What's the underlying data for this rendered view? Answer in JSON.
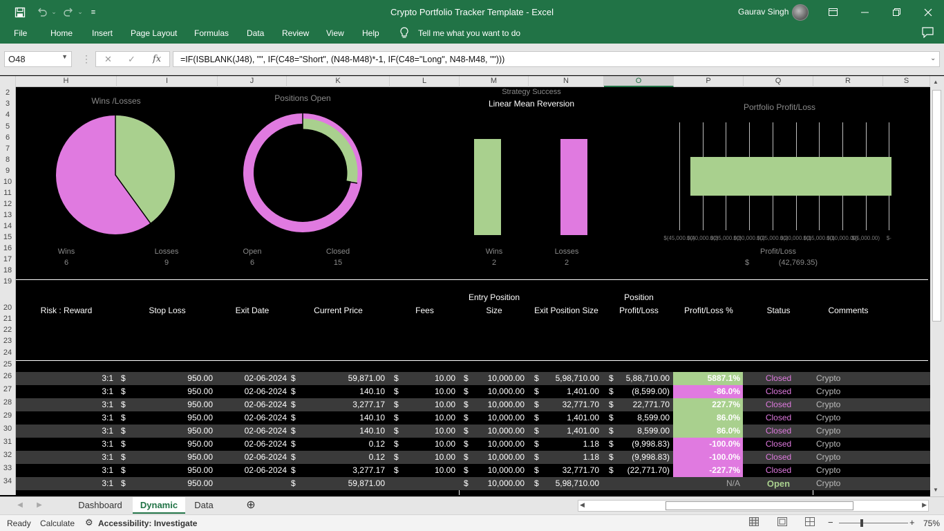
{
  "window": {
    "title": "Crypto Portfolio Tracker Template  -  Excel",
    "user": "Gaurav Singh"
  },
  "quick_access": {
    "save_icon": "save-icon",
    "undo_icon": "undo-icon",
    "redo_icon": "redo-icon"
  },
  "menu": [
    "File",
    "Home",
    "Insert",
    "Page Layout",
    "Formulas",
    "Data",
    "Review",
    "View",
    "Help"
  ],
  "tell_me": "Tell me what you want to do",
  "formula_bar": {
    "name_box": "O48",
    "fx": "fx",
    "formula": "=IF(ISBLANK(J48), \"\", IF(C48=\"Short\", (N48-M48)*-1, IF(C48=\"Long\", N48-M48, \"\")))"
  },
  "columns": [
    "H",
    "I",
    "J",
    "K",
    "L",
    "M",
    "N",
    "O",
    "P",
    "Q",
    "R",
    "S"
  ],
  "selected_column": "O",
  "row_numbers": [
    "2",
    "3",
    "4",
    "5",
    "6",
    "7",
    "8",
    "9",
    "10",
    "11",
    "12",
    "13",
    "14",
    "15",
    "16",
    "17",
    "18",
    "19",
    "20",
    "21",
    "22",
    "23",
    "24",
    "25",
    "26",
    "27",
    "28",
    "29",
    "30",
    "31",
    "32",
    "33",
    "34"
  ],
  "charts": {
    "wins_losses": {
      "title": "Wins /Losses",
      "win_label": "Wins",
      "loss_label": "Losses",
      "wins": "6",
      "losses": "9"
    },
    "positions_open": {
      "title": "Positions Open",
      "open_label": "Open",
      "closed_label": "Closed",
      "open": "6",
      "closed": "15"
    },
    "strategy": {
      "title": "Strategy Success",
      "subtitle": "Linear Mean Reversion",
      "win_label": "Wins",
      "loss_label": "Losses",
      "wins": "2",
      "losses": "2"
    },
    "portfolio": {
      "title": "Portfolio Profit/Loss",
      "label": "Profit/Loss",
      "currency": "$",
      "value": "(42,769.35)",
      "ticks": [
        "$(45,000.00)",
        "$(40,000.00)",
        "$(35,000.00)",
        "$(30,000.00)",
        "$(25,000.00)",
        "$(20,000.00)",
        "$(15,000.00)",
        "$(10,000.00)",
        "$(5,000.00)",
        "$-"
      ]
    }
  },
  "chart_data": [
    {
      "type": "pie",
      "title": "Wins /Losses",
      "categories": [
        "Wins",
        "Losses"
      ],
      "values": [
        6,
        9
      ],
      "colors": [
        "#a9d08e",
        "#e07ae0"
      ]
    },
    {
      "type": "pie",
      "title": "Positions Open",
      "categories": [
        "Open",
        "Closed"
      ],
      "values": [
        6,
        15
      ],
      "colors": [
        "#a9d08e",
        "#e07ae0"
      ]
    },
    {
      "type": "bar",
      "title": "Strategy Success",
      "subtitle": "Linear Mean Reversion",
      "categories": [
        "Wins",
        "Losses"
      ],
      "values": [
        2,
        2
      ],
      "colors": [
        "#a9d08e",
        "#e07ae0"
      ]
    },
    {
      "type": "bar",
      "title": "Portfolio Profit/Loss",
      "categories": [
        "Profit/Loss"
      ],
      "values": [
        -42769.35
      ],
      "xlim": [
        -45000,
        0
      ],
      "orientation": "horizontal",
      "color": "#a9d08e"
    }
  ],
  "table_headers": {
    "risk_reward": "Risk : Reward",
    "stop_loss": "Stop Loss",
    "exit_date": "Exit Date",
    "current_price": "Current Price",
    "fees": "Fees",
    "entry_size_1": "Entry Position",
    "entry_size_2": "Size",
    "exit_size": "Exit Position Size",
    "pl_1": "Position",
    "pl_2": "Profit/Loss",
    "pl_pct": "Profit/Loss %",
    "status": "Status",
    "comments": "Comments"
  },
  "rows": [
    {
      "rr": "3:1",
      "stop": "950.00",
      "exit": "02-06-2024",
      "price": "59,871.00",
      "fees": "10.00",
      "entry": "10,000.00",
      "exitsize": "5,98,710.00",
      "pl": "5,88,710.00",
      "pct": "5887.1%",
      "pct_color": "#a9d08e",
      "status": "Closed",
      "comments": "Crypto"
    },
    {
      "rr": "3:1",
      "stop": "950.00",
      "exit": "02-06-2024",
      "price": "140.10",
      "fees": "10.00",
      "entry": "10,000.00",
      "exitsize": "1,401.00",
      "pl": "(8,599.00)",
      "pct": "-86.0%",
      "pct_color": "#e07ae0",
      "status": "Closed",
      "comments": "Crypto"
    },
    {
      "rr": "3:1",
      "stop": "950.00",
      "exit": "02-06-2024",
      "price": "3,277.17",
      "fees": "10.00",
      "entry": "10,000.00",
      "exitsize": "32,771.70",
      "pl": "22,771.70",
      "pct": "227.7%",
      "pct_color": "#a9d08e",
      "status": "Closed",
      "comments": "Crypto"
    },
    {
      "rr": "3:1",
      "stop": "950.00",
      "exit": "02-06-2024",
      "price": "140.10",
      "fees": "10.00",
      "entry": "10,000.00",
      "exitsize": "1,401.00",
      "pl": "8,599.00",
      "pct": "86.0%",
      "pct_color": "#a9d08e",
      "status": "Closed",
      "comments": "Crypto"
    },
    {
      "rr": "3:1",
      "stop": "950.00",
      "exit": "02-06-2024",
      "price": "140.10",
      "fees": "10.00",
      "entry": "10,000.00",
      "exitsize": "1,401.00",
      "pl": "8,599.00",
      "pct": "86.0%",
      "pct_color": "#a9d08e",
      "status": "Closed",
      "comments": "Crypto"
    },
    {
      "rr": "3:1",
      "stop": "950.00",
      "exit": "02-06-2024",
      "price": "0.12",
      "fees": "10.00",
      "entry": "10,000.00",
      "exitsize": "1.18",
      "pl": "(9,998.83)",
      "pct": "-100.0%",
      "pct_color": "#e07ae0",
      "status": "Closed",
      "comments": "Crypto"
    },
    {
      "rr": "3:1",
      "stop": "950.00",
      "exit": "02-06-2024",
      "price": "0.12",
      "fees": "10.00",
      "entry": "10,000.00",
      "exitsize": "1.18",
      "pl": "(9,998.83)",
      "pct": "-100.0%",
      "pct_color": "#e07ae0",
      "status": "Closed",
      "comments": "Crypto"
    },
    {
      "rr": "3:1",
      "stop": "950.00",
      "exit": "02-06-2024",
      "price": "3,277.17",
      "fees": "10.00",
      "entry": "10,000.00",
      "exitsize": "32,771.70",
      "pl": "(22,771.70)",
      "pct": "-227.7%",
      "pct_color": "#e07ae0",
      "status": "Closed",
      "comments": "Crypto"
    },
    {
      "rr": "3:1",
      "stop": "950.00",
      "exit": "",
      "price": "59,871.00",
      "fees": "",
      "entry": "10,000.00",
      "exitsize": "5,98,710.00",
      "pl": "",
      "pct": "N/A",
      "pct_color": "",
      "status": "Open",
      "comments": "Crypto"
    }
  ],
  "sheet_tabs": [
    "Dashboard",
    "Dynamic",
    "Data"
  ],
  "active_tab": "Dynamic",
  "status": {
    "ready": "Ready",
    "calculate": "Calculate",
    "accessibility": "Accessibility: Investigate",
    "zoom": "75%"
  }
}
